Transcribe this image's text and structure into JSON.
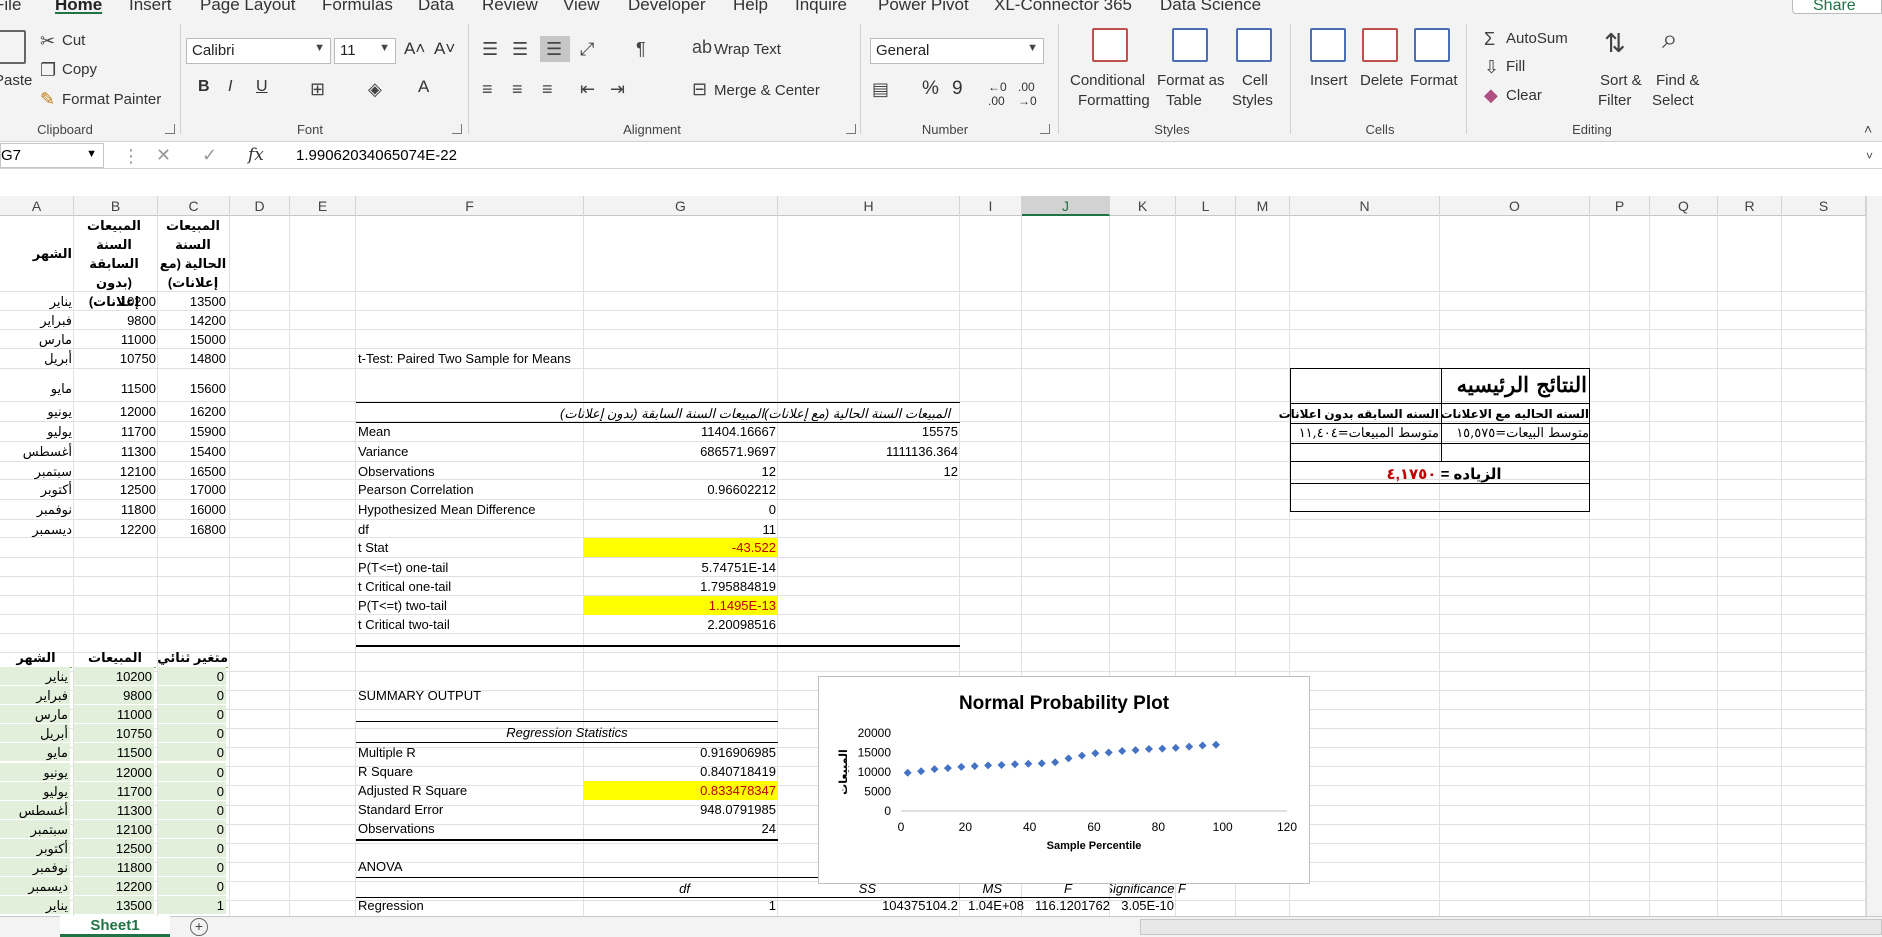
{
  "tabs": [
    "File",
    "Home",
    "Insert",
    "Page Layout",
    "Formulas",
    "Data",
    "Review",
    "View",
    "Developer",
    "Help",
    "Inquire",
    "Power Pivot",
    "XL-Connector 365",
    "Data Science"
  ],
  "active_tab": "Home",
  "share_label": "Share",
  "ribbon": {
    "clipboard": {
      "paste": "Paste",
      "cut": "Cut",
      "copy": "Copy",
      "format_painter": "Format Painter",
      "label": "Clipboard"
    },
    "font": {
      "name": "Calibri",
      "size": "11",
      "bold": "B",
      "italic": "I",
      "underline": "U",
      "label": "Font"
    },
    "alignment": {
      "wrap_text": "Wrap Text",
      "merge_center": "Merge & Center",
      "label": "Alignment"
    },
    "number": {
      "format": "General",
      "percent": "%",
      "comma": "9",
      "label": "Number"
    },
    "styles": {
      "conditional": "Conditional",
      "conditional2": "Formatting",
      "format_as": "Format as",
      "format_as2": "Table",
      "cell": "Cell",
      "cell2": "Styles",
      "label": "Styles"
    },
    "cells": {
      "insert": "Insert",
      "delete": "Delete",
      "format": "Format",
      "label": "Cells"
    },
    "editing": {
      "autosum": "AutoSum",
      "fill": "Fill",
      "clear": "Clear",
      "sort": "Sort &",
      "sort2": "Filter",
      "find": "Find &",
      "find2": "Select",
      "label": "Editing"
    }
  },
  "formula_bar": {
    "name_box": "G7",
    "fx": "fx",
    "value": "1.99062034065074E-22"
  },
  "columns": [
    "A",
    "B",
    "C",
    "D",
    "E",
    "F",
    "G",
    "H",
    "I",
    "J",
    "K",
    "L",
    "M",
    "N",
    "O",
    "P",
    "Q",
    "R",
    "S"
  ],
  "selected_column": "J",
  "table1": {
    "headers": {
      "month": "الشهر",
      "prev": "المبيعات السنة السابقة (بدون إعلانات)",
      "curr": "المبيعات السنة الحالية (مع إعلانات)"
    },
    "rows": [
      [
        "يناير",
        "10200",
        "13500"
      ],
      [
        "فبراير",
        "9800",
        "14200"
      ],
      [
        "مارس",
        "11000",
        "15000"
      ],
      [
        "أبريل",
        "10750",
        "14800"
      ],
      [
        "مايو",
        "11500",
        "15600"
      ],
      [
        "يونيو",
        "12000",
        "16200"
      ],
      [
        "يوليو",
        "11700",
        "15900"
      ],
      [
        "أغسطس",
        "11300",
        "15400"
      ],
      [
        "سبتمبر",
        "12100",
        "16500"
      ],
      [
        "أكتوبر",
        "12500",
        "17000"
      ],
      [
        "نوفمبر",
        "11800",
        "16000"
      ],
      [
        "ديسمبر",
        "12200",
        "16800"
      ]
    ]
  },
  "table2": {
    "headers": {
      "month": "الشهر",
      "sales": "المبيعات",
      "dummy": "متغير ثنائي"
    },
    "rows": [
      [
        "يناير",
        "10200",
        "0"
      ],
      [
        "فبراير",
        "9800",
        "0"
      ],
      [
        "مارس",
        "11000",
        "0"
      ],
      [
        "أبريل",
        "10750",
        "0"
      ],
      [
        "مايو",
        "11500",
        "0"
      ],
      [
        "يونيو",
        "12000",
        "0"
      ],
      [
        "يوليو",
        "11700",
        "0"
      ],
      [
        "أغسطس",
        "11300",
        "0"
      ],
      [
        "سبتمبر",
        "12100",
        "0"
      ],
      [
        "أكتوبر",
        "12500",
        "0"
      ],
      [
        "نوفمبر",
        "11800",
        "0"
      ],
      [
        "ديسمبر",
        "12200",
        "0"
      ],
      [
        "يناير",
        "13500",
        "1"
      ]
    ]
  },
  "ttest": {
    "title": "t-Test: Paired Two Sample for Means",
    "col1": "المبيعات السنة الحالية (مع إعلانات)",
    "col2": "المبيعات السنة السابقة (بدون إعلانات)",
    "rows": [
      {
        "label": "Mean",
        "v1": "11404.16667",
        "v2": "15575"
      },
      {
        "label": "Variance",
        "v1": "686571.9697",
        "v2": "1111136.364"
      },
      {
        "label": "Observations",
        "v1": "12",
        "v2": "12"
      },
      {
        "label": "Pearson Correlation",
        "v1": "0.96602212",
        "v2": ""
      },
      {
        "label": "Hypothesized Mean Difference",
        "v1": "0",
        "v2": ""
      },
      {
        "label": "df",
        "v1": "11",
        "v2": ""
      },
      {
        "label": "t Stat",
        "v1": "-43.522",
        "v2": ""
      },
      {
        "label": "P(T<=t) one-tail",
        "v1": "5.74751E-14",
        "v2": ""
      },
      {
        "label": "t Critical one-tail",
        "v1": "1.795884819",
        "v2": ""
      },
      {
        "label": "P(T<=t) two-tail",
        "v1": "1.1495E-13",
        "v2": ""
      },
      {
        "label": "t Critical two-tail",
        "v1": "2.20098516",
        "v2": ""
      }
    ]
  },
  "summary": {
    "title": "SUMMARY OUTPUT",
    "reg_header": "Regression Statistics",
    "rows": [
      {
        "label": "Multiple R",
        "v": "0.916906985"
      },
      {
        "label": "R Square",
        "v": "0.840718419"
      },
      {
        "label": "Adjusted R Square",
        "v": "0.833478347"
      },
      {
        "label": "Standard Error",
        "v": "948.0791985"
      },
      {
        "label": "Observations",
        "v": "24"
      }
    ],
    "anova": "ANOVA",
    "anova_headers": [
      "df",
      "SS",
      "MS",
      "F",
      "Significance F"
    ],
    "anova_row": {
      "label": "Regression",
      "df": "1",
      "ss": "104375104.2",
      "ms": "1.04E+08",
      "f": "116.1201762",
      "sig": "3.05E-10"
    }
  },
  "results_box": {
    "title": "النتائج الرئيسيه",
    "h1": "السنه الحاليه مع الاعلانات",
    "h2": "السنه السابقه بدون اعلانات",
    "v1": "متوسط البيعات=١٥,٥٧٥",
    "v2": "متوسط المبيعات=١١,٤٠٤",
    "increase_label": "الزياده =",
    "increase_value": "٤,١٧٥٠"
  },
  "chart_data": {
    "type": "scatter",
    "title": "Normal Probability Plot",
    "xlabel": "Sample Percentile",
    "ylabel": "المبيعات",
    "xlim": [
      0,
      120
    ],
    "ylim": [
      0,
      20000
    ],
    "xticks": [
      "0",
      "20",
      "40",
      "60",
      "80",
      "100",
      "120"
    ],
    "yticks": [
      "0",
      "5000",
      "10000",
      "15000",
      "20000"
    ],
    "x": [
      2.08,
      6.25,
      10.42,
      14.58,
      18.75,
      22.92,
      27.08,
      31.25,
      35.42,
      39.58,
      43.75,
      47.92,
      52.08,
      56.25,
      60.42,
      64.58,
      68.75,
      72.92,
      77.08,
      81.25,
      85.42,
      89.58,
      93.75,
      97.92
    ],
    "y": [
      9800,
      10200,
      10750,
      11000,
      11300,
      11500,
      11700,
      11800,
      12000,
      12100,
      12200,
      12500,
      13500,
      14200,
      14800,
      15000,
      15400,
      15600,
      15900,
      16000,
      16200,
      16500,
      16800,
      17000
    ],
    "color": "#4472c4"
  },
  "sheet": {
    "name": "Sheet1",
    "add": "+"
  }
}
